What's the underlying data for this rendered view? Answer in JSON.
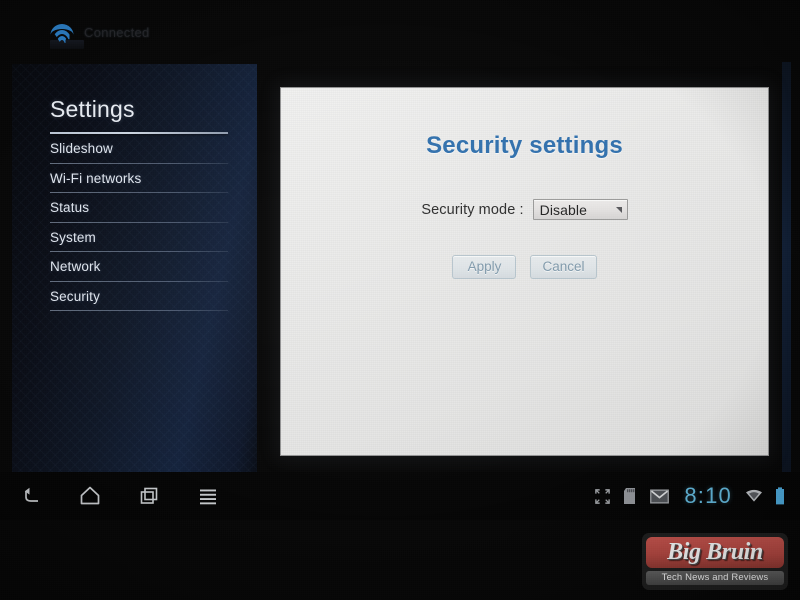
{
  "topbar": {
    "wifi_icon": "wifi-icon",
    "status_text": "Connected"
  },
  "sidebar": {
    "title": "Settings",
    "items": [
      {
        "label": "Slideshow"
      },
      {
        "label": "Wi-Fi networks"
      },
      {
        "label": "Status"
      },
      {
        "label": "System"
      },
      {
        "label": "Network"
      },
      {
        "label": "Security"
      }
    ]
  },
  "content": {
    "title": "Security settings",
    "form": {
      "security_mode_label": "Security mode :",
      "security_mode_value": "Disable",
      "security_mode_options": [
        "Disable"
      ],
      "dropdown_icon": "triangle-down-icon"
    },
    "buttons": {
      "apply_label": "Apply",
      "cancel_label": "Cancel"
    }
  },
  "systembar": {
    "nav": [
      {
        "name": "back-icon"
      },
      {
        "name": "home-icon"
      },
      {
        "name": "recent-apps-icon"
      },
      {
        "name": "menu-icon"
      }
    ],
    "status": [
      {
        "name": "fullscreen-icon"
      },
      {
        "name": "sd-card-icon"
      },
      {
        "name": "mail-icon"
      }
    ],
    "clock": "8:10",
    "wifi_icon": "wifi-icon",
    "battery_icon": "battery-icon"
  },
  "watermark": {
    "brand": "Big Bruin",
    "tagline": "Tech News and Reviews"
  },
  "colors": {
    "accent_blue": "#2f6fad",
    "clock_blue": "#5fb3d6",
    "wifi_blue": "#2a7ec6",
    "panel_bg": "#e9e9e8",
    "sidebar_navy": "#12203a",
    "watermark_red": "#b0453f"
  }
}
